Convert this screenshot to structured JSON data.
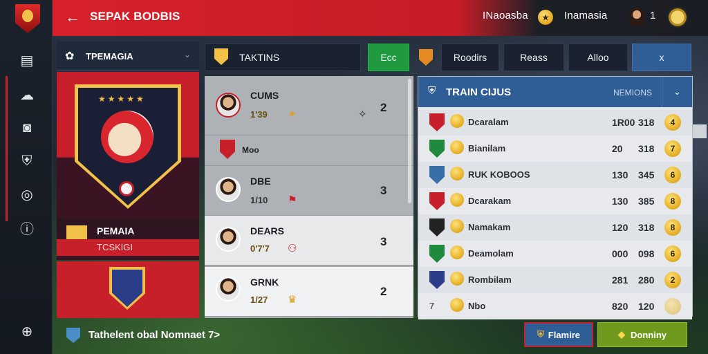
{
  "colors": {
    "primary": "#d8202a",
    "panel_dark": "#1a2230",
    "accent_green": "#1f9a3e",
    "accent_blue": "#2f5d96",
    "gold": "#e2a41a"
  },
  "header": {
    "back_icon": "arrow-left-icon",
    "title": "SEPAK BODBIS",
    "right_label_1": "INaoasba",
    "right_label_2": "Inamasia",
    "player_count": "1"
  },
  "sidebar": {
    "items": [
      "menu-icon",
      "social-icon",
      "camera-icon",
      "shield-icon",
      "target-icon",
      "info-icon",
      "download-icon"
    ]
  },
  "crest_panel": {
    "title": "TPEMAGIA",
    "team_name": "PEMAIA",
    "team_subtitle": "TCSKIGI"
  },
  "tabs": {
    "tactics_label": "TAKTINS",
    "green_label": "Ecc",
    "btn1": "Roodirs",
    "btn2": "Reass",
    "btn3": "Alloo",
    "btn4": "x"
  },
  "players": [
    {
      "name": "CUMS",
      "sub": "1'39",
      "num": "2"
    },
    {
      "name": "Moo",
      "sub": "",
      "num": ""
    },
    {
      "name": "DBE",
      "sub": "1/10",
      "num": "3"
    },
    {
      "name": "DEARS",
      "sub": "0'7'7",
      "num": "3"
    },
    {
      "name": "GRNK",
      "sub": "1/27",
      "num": "2"
    }
  ],
  "table": {
    "title": "TRAIN CIJUS",
    "header_right": "NEMIONS",
    "rows": [
      {
        "name": "Dcaralam",
        "a": "1R00",
        "b": "318",
        "rank": "4"
      },
      {
        "name": "Bianilam",
        "a": "20",
        "b": "318",
        "rank": "7"
      },
      {
        "name": "RUK KOBOOS",
        "a": "130",
        "b": "345",
        "rank": "6"
      },
      {
        "name": "Dcarakam",
        "a": "130",
        "b": "385",
        "rank": "8"
      },
      {
        "name": "Namakam",
        "a": "120",
        "b": "318",
        "rank": "8"
      },
      {
        "name": "Deamolam",
        "a": "000",
        "b": "098",
        "rank": "6"
      },
      {
        "name": "Rombilam",
        "a": "281",
        "b": "280",
        "rank": "2"
      },
      {
        "name": "Nbo",
        "a": "820",
        "b": "120",
        "rank": ""
      }
    ],
    "last_row_prefix": "7"
  },
  "footer": {
    "text": "Tathelent obal Nomnaet 7>",
    "blue_btn": "Flamire",
    "green_btn": "Donniny"
  }
}
